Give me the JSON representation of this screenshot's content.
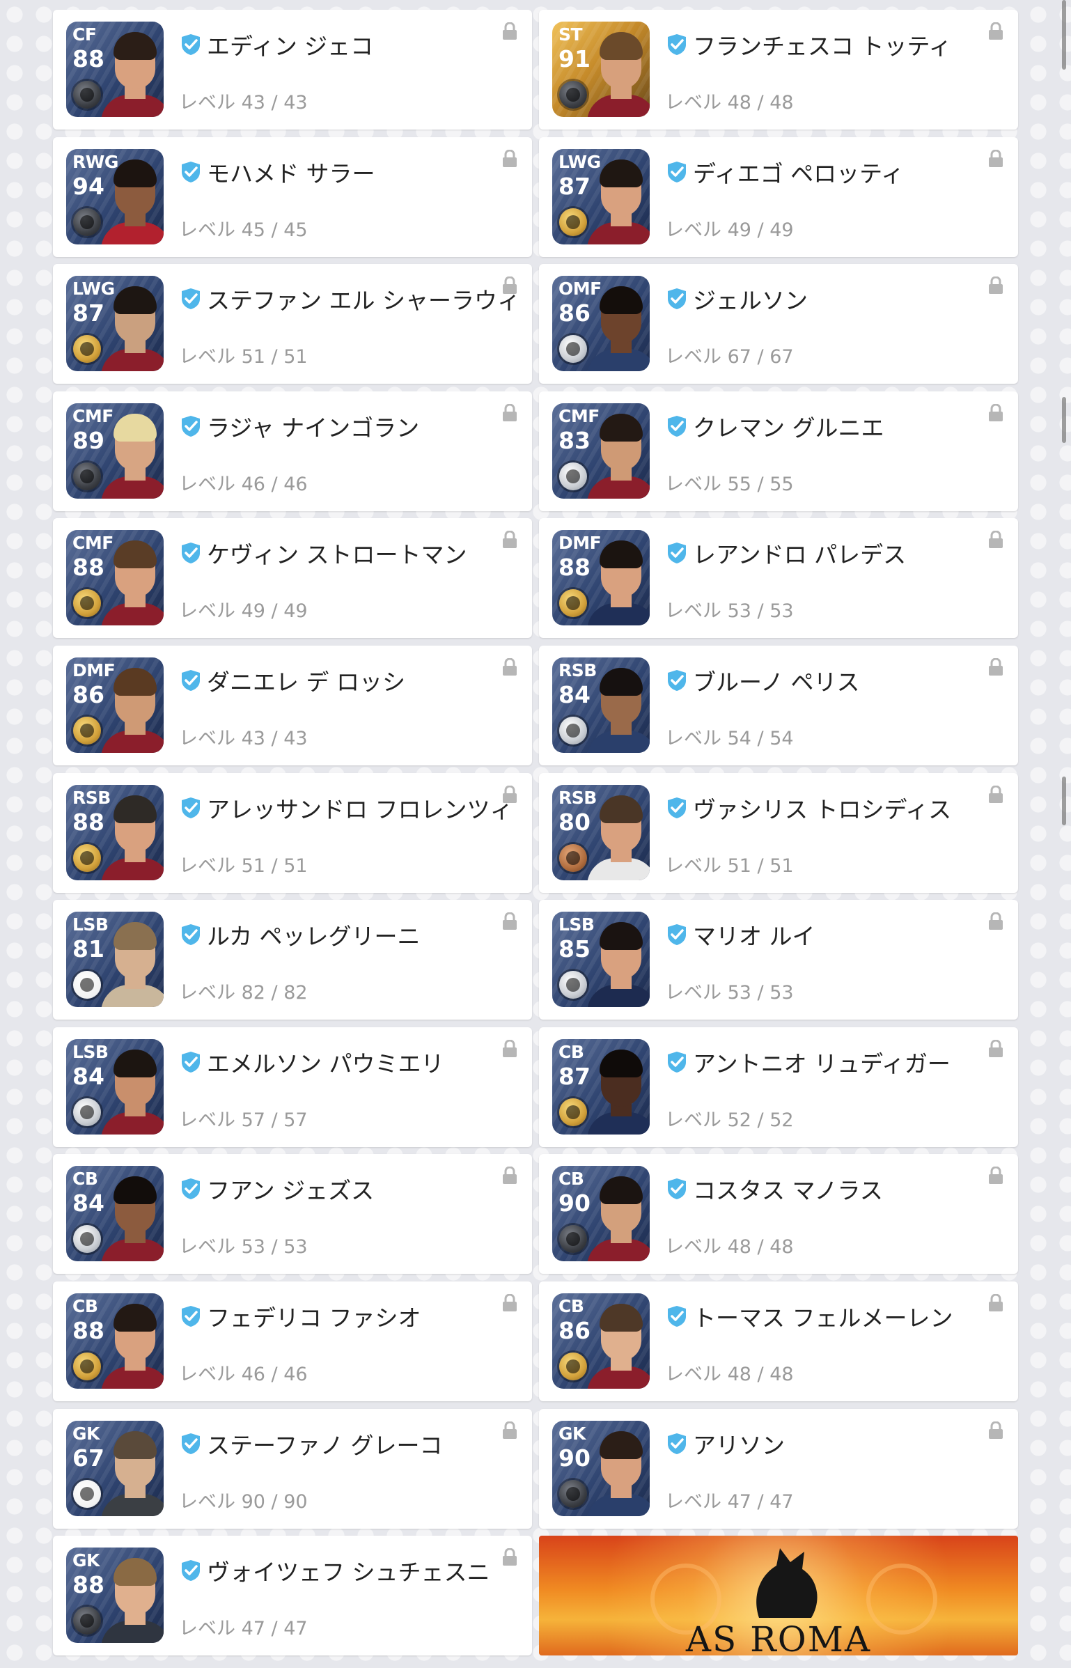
{
  "players": [
    {
      "position": "CF",
      "rating": "88",
      "name": "エディン ジェコ",
      "level": "レベル 43 / 43",
      "card": "blue",
      "coin": "black",
      "shirt": "#8b1e2b",
      "skin": "#d9a17f",
      "hair": "#2b1e17"
    },
    {
      "position": "ST",
      "rating": "91",
      "name": "フランチェスコ トッティ",
      "level": "レベル 48 / 48",
      "card": "gold",
      "coin": "black",
      "shirt": "#8b1e2b",
      "skin": "#d7a07c",
      "hair": "#6b4a2a"
    },
    {
      "position": "RWG",
      "rating": "94",
      "name": "モハメド サラー",
      "level": "レベル 45 / 45",
      "card": "blue",
      "coin": "black",
      "shirt": "#b2212e",
      "skin": "#8c5b3e",
      "hair": "#1c1410"
    },
    {
      "position": "LWG",
      "rating": "87",
      "name": "ディエゴ ペロッティ",
      "level": "レベル 49 / 49",
      "card": "blue",
      "coin": "gold",
      "shirt": "#8b1e2b",
      "skin": "#d9a17f",
      "hair": "#1f1712"
    },
    {
      "position": "LWG",
      "rating": "87",
      "name": "ステファン エル シャーラウィ",
      "level": "レベル 51 / 51",
      "card": "blue",
      "coin": "gold",
      "shirt": "#8b1e2b",
      "skin": "#caa07f",
      "hair": "#1d1612"
    },
    {
      "position": "OMF",
      "rating": "86",
      "name": "ジェルソン",
      "level": "レベル 67 / 67",
      "card": "blue",
      "coin": "silver",
      "shirt": "#2a3f6b",
      "skin": "#6d432c",
      "hair": "#140e0b"
    },
    {
      "position": "CMF",
      "rating": "89",
      "name": "ラジャ ナインゴラン",
      "level": "レベル 46 / 46",
      "card": "blue",
      "coin": "black",
      "shirt": "#8b1e2b",
      "skin": "#d7a583",
      "hair": "#e7d9a0"
    },
    {
      "position": "CMF",
      "rating": "83",
      "name": "クレマン グルニエ",
      "level": "レベル 55 / 55",
      "card": "blue",
      "coin": "silver",
      "shirt": "#8b1e2b",
      "skin": "#cf9a75",
      "hair": "#231914"
    },
    {
      "position": "CMF",
      "rating": "88",
      "name": "ケヴィン ストロートマン",
      "level": "レベル 49 / 49",
      "card": "blue",
      "coin": "gold",
      "shirt": "#8b1e2b",
      "skin": "#d9a17f",
      "hair": "#5a3d26"
    },
    {
      "position": "DMF",
      "rating": "88",
      "name": "レアンドロ パレデス",
      "level": "レベル 53 / 53",
      "card": "blue",
      "coin": "gold",
      "shirt": "#1f2f57",
      "skin": "#d9a17f",
      "hair": "#1b1410"
    },
    {
      "position": "DMF",
      "rating": "86",
      "name": "ダニエレ デ ロッシ",
      "level": "レベル 43 / 43",
      "card": "blue",
      "coin": "gold",
      "shirt": "#8b1e2b",
      "skin": "#cf9a75",
      "hair": "#5a3a22"
    },
    {
      "position": "RSB",
      "rating": "84",
      "name": "ブルーノ ペリス",
      "level": "レベル 54 / 54",
      "card": "blue",
      "coin": "silver",
      "shirt": "#2a3f6b",
      "skin": "#9a6a4a",
      "hair": "#161110"
    },
    {
      "position": "RSB",
      "rating": "88",
      "name": "アレッサンドロ フロレンツィ",
      "level": "レベル 51 / 51",
      "card": "blue",
      "coin": "gold",
      "shirt": "#8b1e2b",
      "skin": "#d9a17f",
      "hair": "#2e2a26"
    },
    {
      "position": "RSB",
      "rating": "80",
      "name": "ヴァシリス トロシディス",
      "level": "レベル 51 / 51",
      "card": "blue",
      "coin": "bronze",
      "shirt": "#e8e8e8",
      "skin": "#d9a17f",
      "hair": "#4a3626"
    },
    {
      "position": "LSB",
      "rating": "81",
      "name": "ルカ ペッレグリーニ",
      "level": "レベル 82 / 82",
      "card": "blue",
      "coin": "white",
      "shirt": "#c9b79c",
      "skin": "#d6b090",
      "hair": "#8a7050"
    },
    {
      "position": "LSB",
      "rating": "85",
      "name": "マリオ ルイ",
      "level": "レベル 53 / 53",
      "card": "blue",
      "coin": "silver",
      "shirt": "#1d2b50",
      "skin": "#d9a17f",
      "hair": "#1a1311"
    },
    {
      "position": "LSB",
      "rating": "84",
      "name": "エメルソン パウミエリ",
      "level": "レベル 57 / 57",
      "card": "blue",
      "coin": "silver",
      "shirt": "#8b1e2b",
      "skin": "#c98f6c",
      "hair": "#1c1511"
    },
    {
      "position": "CB",
      "rating": "87",
      "name": "アントニオ リュディガー",
      "level": "レベル 52 / 52",
      "card": "blue",
      "coin": "gold",
      "shirt": "#1f2f57",
      "skin": "#4b2d20",
      "hair": "#0f0b09"
    },
    {
      "position": "CB",
      "rating": "84",
      "name": "フアン ジェズス",
      "level": "レベル 53 / 53",
      "card": "blue",
      "coin": "silver",
      "shirt": "#8b1e2b",
      "skin": "#8c5b3e",
      "hair": "#120d0b"
    },
    {
      "position": "CB",
      "rating": "90",
      "name": "コスタス マノラス",
      "level": "レベル 48 / 48",
      "card": "blue",
      "coin": "black",
      "shirt": "#8b1e2b",
      "skin": "#d3a07c",
      "hair": "#1b1411"
    },
    {
      "position": "CB",
      "rating": "88",
      "name": "フェデリコ ファシオ",
      "level": "レベル 46 / 46",
      "card": "blue",
      "coin": "gold",
      "shirt": "#8b1e2b",
      "skin": "#d9a17f",
      "hair": "#231914"
    },
    {
      "position": "CB",
      "rating": "86",
      "name": "トーマス フェルメーレン",
      "level": "レベル 48 / 48",
      "card": "blue",
      "coin": "gold",
      "shirt": "#8b1e2b",
      "skin": "#e0b08e",
      "hair": "#4e3827"
    },
    {
      "position": "GK",
      "rating": "67",
      "name": "ステーファノ グレーコ",
      "level": "レベル 90 / 90",
      "card": "blue",
      "coin": "white",
      "shirt": "#3b3f44",
      "skin": "#d6b090",
      "hair": "#5a4a3a"
    },
    {
      "position": "GK",
      "rating": "90",
      "name": "アリソン",
      "level": "レベル 47 / 47",
      "card": "blue",
      "coin": "black",
      "shirt": "#2a3f6b",
      "skin": "#d9a17f",
      "hair": "#2b1e17"
    },
    {
      "position": "GK",
      "rating": "88",
      "name": "ヴォイツェフ シュチェスニ",
      "level": "レベル 47 / 47",
      "card": "blue",
      "coin": "black",
      "shirt": "#2f3540",
      "skin": "#e0b08e",
      "hair": "#8a6a44"
    }
  ],
  "banner": {
    "text": "AS ROMA"
  },
  "icons": {
    "verified": "shield-check-icon",
    "lock": "lock-icon"
  },
  "colors": {
    "verified_blue": "#4fb6ea",
    "lock_gray": "#b6b6b6",
    "banner_orange": "#f08a22"
  }
}
